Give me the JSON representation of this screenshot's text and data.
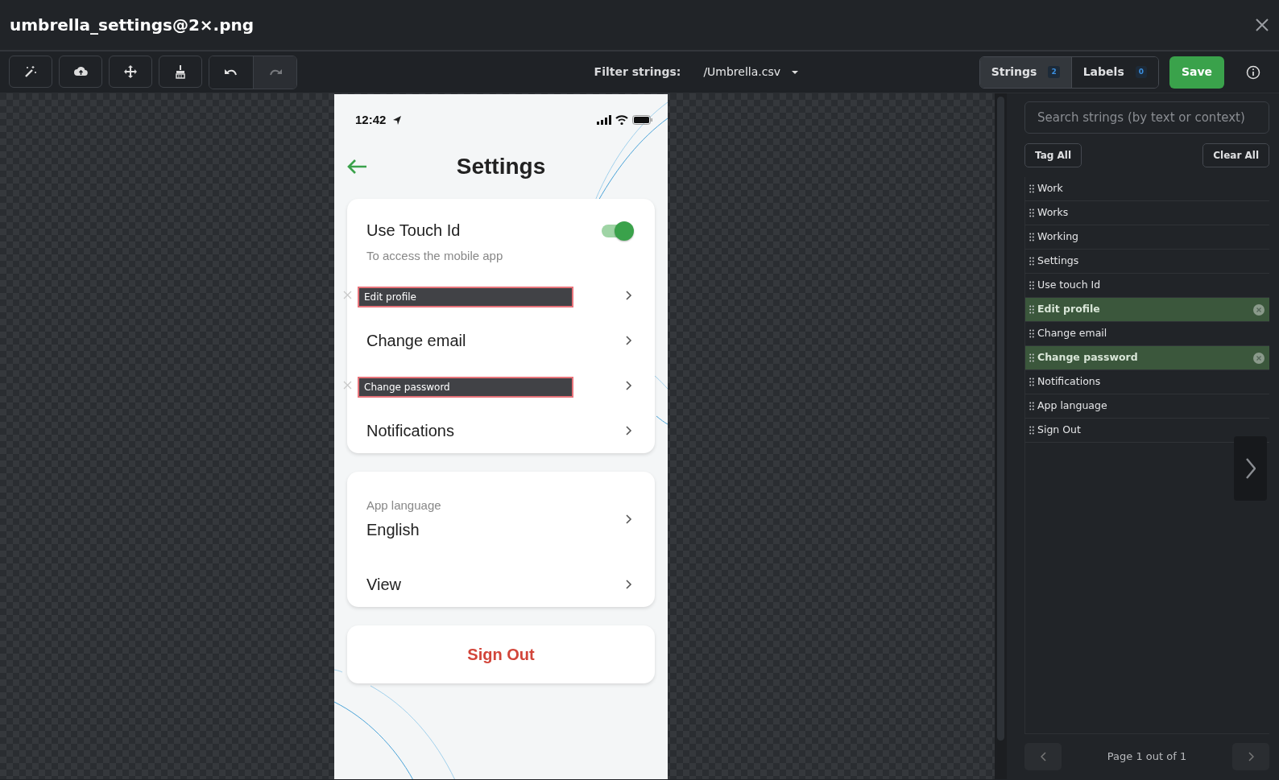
{
  "file_title": "umbrella_settings@2×.png",
  "tools": [
    {
      "kind": "wand",
      "disabled": false
    },
    {
      "kind": "upload",
      "disabled": false
    },
    {
      "kind": "move",
      "disabled": false
    },
    {
      "kind": "broom",
      "disabled": false
    },
    {
      "kind": "undo",
      "disabled": false
    },
    {
      "kind": "redo",
      "disabled": true
    }
  ],
  "filter": {
    "label": "Filter strings:",
    "file": "/Umbrella.csv"
  },
  "tabs": [
    {
      "label": "Strings",
      "count": "2",
      "selected": true
    },
    {
      "label": "Labels",
      "count": "0",
      "selected": false
    }
  ],
  "save": "Save",
  "phone": {
    "time": "12:42",
    "title": "Settings",
    "groups": [
      {
        "rows": [
          {
            "kind": "toggle",
            "label": "Use Touch Id",
            "subtitle": "To access the mobile app",
            "on": true
          },
          {
            "kind": "link",
            "tag": "Edit profile"
          },
          {
            "kind": "link",
            "label": "Change email"
          },
          {
            "kind": "link",
            "tag": "Change password"
          },
          {
            "kind": "link",
            "label": "Notifications"
          }
        ]
      },
      {
        "rows": [
          {
            "kind": "link",
            "overline": "App language",
            "label": "English"
          },
          {
            "kind": "link",
            "label": "View"
          }
        ]
      }
    ],
    "sign_out": "Sign Out"
  },
  "panel": {
    "search_placeholder": "Search strings (by text or context)",
    "tag_all": "Tag All",
    "clear_all": "Clear All",
    "strings": [
      {
        "text": "Work",
        "tagged": false
      },
      {
        "text": "Works",
        "tagged": false
      },
      {
        "text": "Working",
        "tagged": false
      },
      {
        "text": "Settings",
        "tagged": false
      },
      {
        "text": "Use touch Id",
        "tagged": false
      },
      {
        "text": "Edit profile",
        "tagged": true
      },
      {
        "text": "Change email",
        "tagged": false
      },
      {
        "text": "Change password",
        "tagged": true
      },
      {
        "text": "Notifications",
        "tagged": false
      },
      {
        "text": "App language",
        "tagged": false
      },
      {
        "text": "Sign Out",
        "tagged": false
      }
    ],
    "pagination": "Page 1 out of 1"
  }
}
